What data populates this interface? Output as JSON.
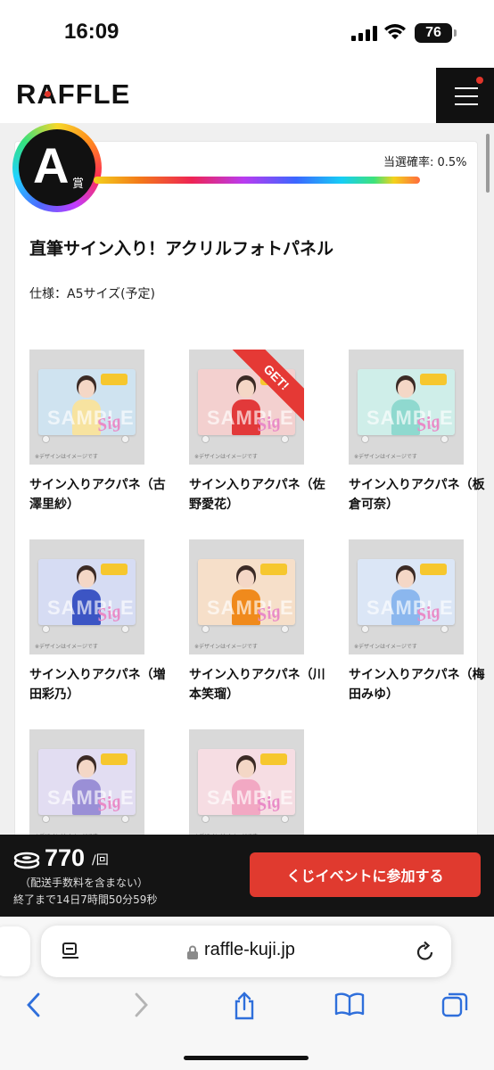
{
  "status_bar": {
    "time": "16:09",
    "battery": "76"
  },
  "header": {
    "logo": "RAFFLE"
  },
  "prize": {
    "rank_letter": "A",
    "rank_suffix": "賞",
    "probability": "当選確率: 0.5%",
    "title": "直筆サイン入り！アクリルフォトパネル",
    "spec": "仕様：A5サイズ(予定)",
    "image_watermark": "SAMPLE",
    "image_note": "※デザインはイメージです",
    "get_label": "GET!",
    "items": [
      {
        "name": "サイン入りアクパネ（古澤里紗）",
        "bg": "#cfe3f0",
        "outfit": "#f7e3a0",
        "won": false
      },
      {
        "name": "サイン入りアクパネ（佐野愛花）",
        "bg": "#f3d0cf",
        "outfit": "#e2393a",
        "won": true
      },
      {
        "name": "サイン入りアクパネ（板倉可奈）",
        "bg": "#cfeee9",
        "outfit": "#8fd9cf",
        "won": false
      },
      {
        "name": "サイン入りアクパネ（増田彩乃）",
        "bg": "#d6dcf3",
        "outfit": "#3c55c4",
        "won": false
      },
      {
        "name": "サイン入りアクパネ（川本笑瑠）",
        "bg": "#f6dfc9",
        "outfit": "#f08a1c",
        "won": false
      },
      {
        "name": "サイン入りアクパネ（梅田みゆ）",
        "bg": "#dbe6f6",
        "outfit": "#8bb7ee",
        "won": false
      },
      {
        "name": "",
        "bg": "#e2ddf2",
        "outfit": "#9a8fd6",
        "won": false
      },
      {
        "name": "",
        "bg": "#f6dde3",
        "outfit": "#f2a8c3",
        "won": false
      }
    ]
  },
  "purchase": {
    "price": "770",
    "unit": "/回",
    "shipping_note": "（配送手数料を含まない）",
    "time_left": "終了まで14日7時間50分59秒",
    "button_label": "くじイベントに参加する"
  },
  "browser": {
    "url": "raffle-kuji.jp"
  }
}
